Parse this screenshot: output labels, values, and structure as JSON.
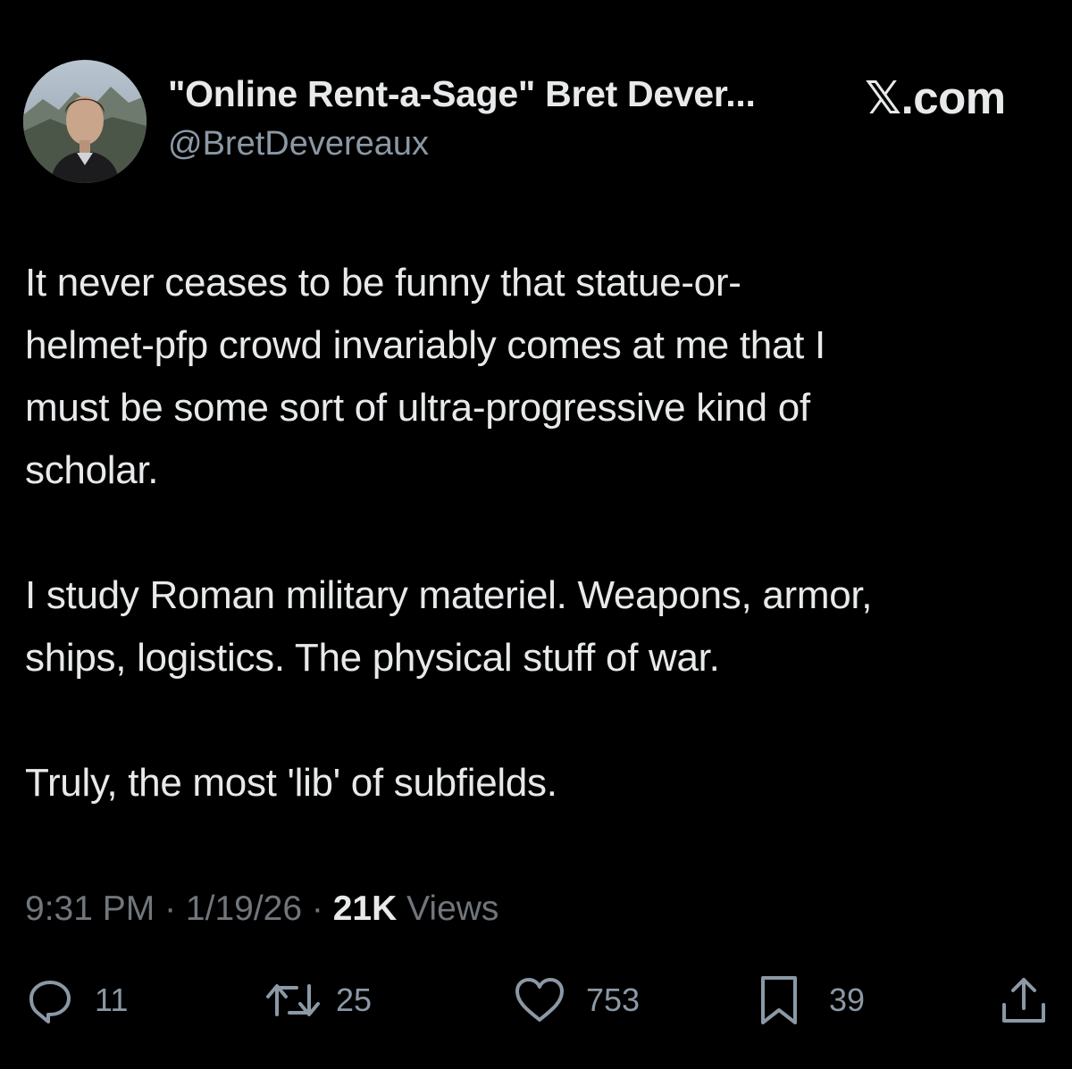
{
  "header": {
    "display_name": "\"Online Rent-a-Sage\" Bret Dever...",
    "handle": "@BretDevereaux",
    "brand": "𝕏.com"
  },
  "tweet": {
    "paragraphs": [
      "It never ceases to be funny that statue-or-\nhelmet-pfp crowd invariably comes at me that I\nmust be some sort of ultra-progressive kind of\nscholar.",
      "I study Roman military materiel. Weapons, armor,\nships, logistics.  The physical stuff of war.",
      "Truly, the most 'lib' of subfields."
    ]
  },
  "meta": {
    "time": "9:31 PM",
    "separator": " · ",
    "date": "1/19/26",
    "views_count": "21K",
    "views_label": " Views"
  },
  "actions": {
    "replies": "11",
    "reposts": "25",
    "likes": "753",
    "bookmarks": "39"
  },
  "icons": {
    "reply": "speech-bubble-icon",
    "repost": "repost-arrows-icon",
    "like": "heart-icon",
    "bookmark": "bookmark-icon",
    "share": "share-upload-icon"
  },
  "colors": {
    "background": "#000000",
    "text": "#e7e9ea",
    "secondary_text": "#71767b",
    "icon": "#8b98a5"
  }
}
